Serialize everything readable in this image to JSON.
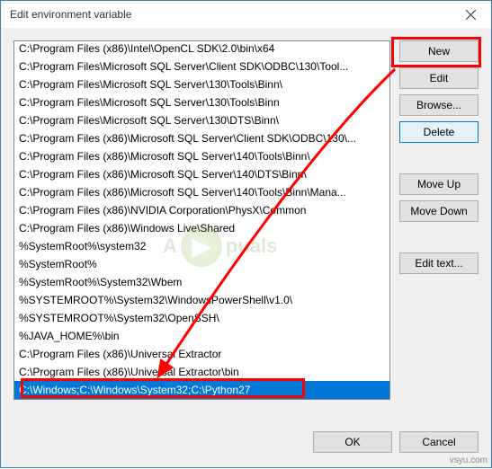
{
  "window": {
    "title": "Edit environment variable"
  },
  "list": {
    "items": [
      "C:\\Program Files (x86)\\Intel\\OpenCL SDK\\2.0\\bin\\x64",
      "C:\\Program Files\\Microsoft SQL Server\\Client SDK\\ODBC\\130\\Tool...",
      "C:\\Program Files\\Microsoft SQL Server\\130\\Tools\\Binn\\",
      "C:\\Program Files\\Microsoft SQL Server\\130\\Tools\\Binn",
      "C:\\Program Files\\Microsoft SQL Server\\130\\DTS\\Binn\\",
      "C:\\Program Files (x86)\\Microsoft SQL Server\\Client SDK\\ODBC\\130\\...",
      "C:\\Program Files (x86)\\Microsoft SQL Server\\140\\Tools\\Binn\\",
      "C:\\Program Files (x86)\\Microsoft SQL Server\\140\\DTS\\Binn\\",
      "C:\\Program Files (x86)\\Microsoft SQL Server\\140\\Tools\\Binn\\Mana...",
      "C:\\Program Files (x86)\\NVIDIA Corporation\\PhysX\\Common",
      "C:\\Program Files (x86)\\Windows Live\\Shared",
      "%SystemRoot%\\system32",
      "%SystemRoot%",
      "%SystemRoot%\\System32\\Wbem",
      "%SYSTEMROOT%\\System32\\WindowsPowerShell\\v1.0\\",
      "%SYSTEMROOT%\\System32\\OpenSSH\\",
      "%JAVA_HOME%\\bin",
      "C:\\Program Files (x86)\\Universal Extractor",
      "C:\\Program Files (x86)\\Universal Extractor\\bin",
      "C:\\Windows;C:\\Windows\\System32;C:\\Python27"
    ],
    "selected_index": 19
  },
  "buttons": {
    "new": "New",
    "edit": "Edit",
    "browse": "Browse...",
    "delete": "Delete",
    "moveup": "Move Up",
    "movedown": "Move Down",
    "edittext": "Edit text...",
    "ok": "OK",
    "cancel": "Cancel"
  },
  "watermark": "A  puals",
  "source": "vsyu.com"
}
